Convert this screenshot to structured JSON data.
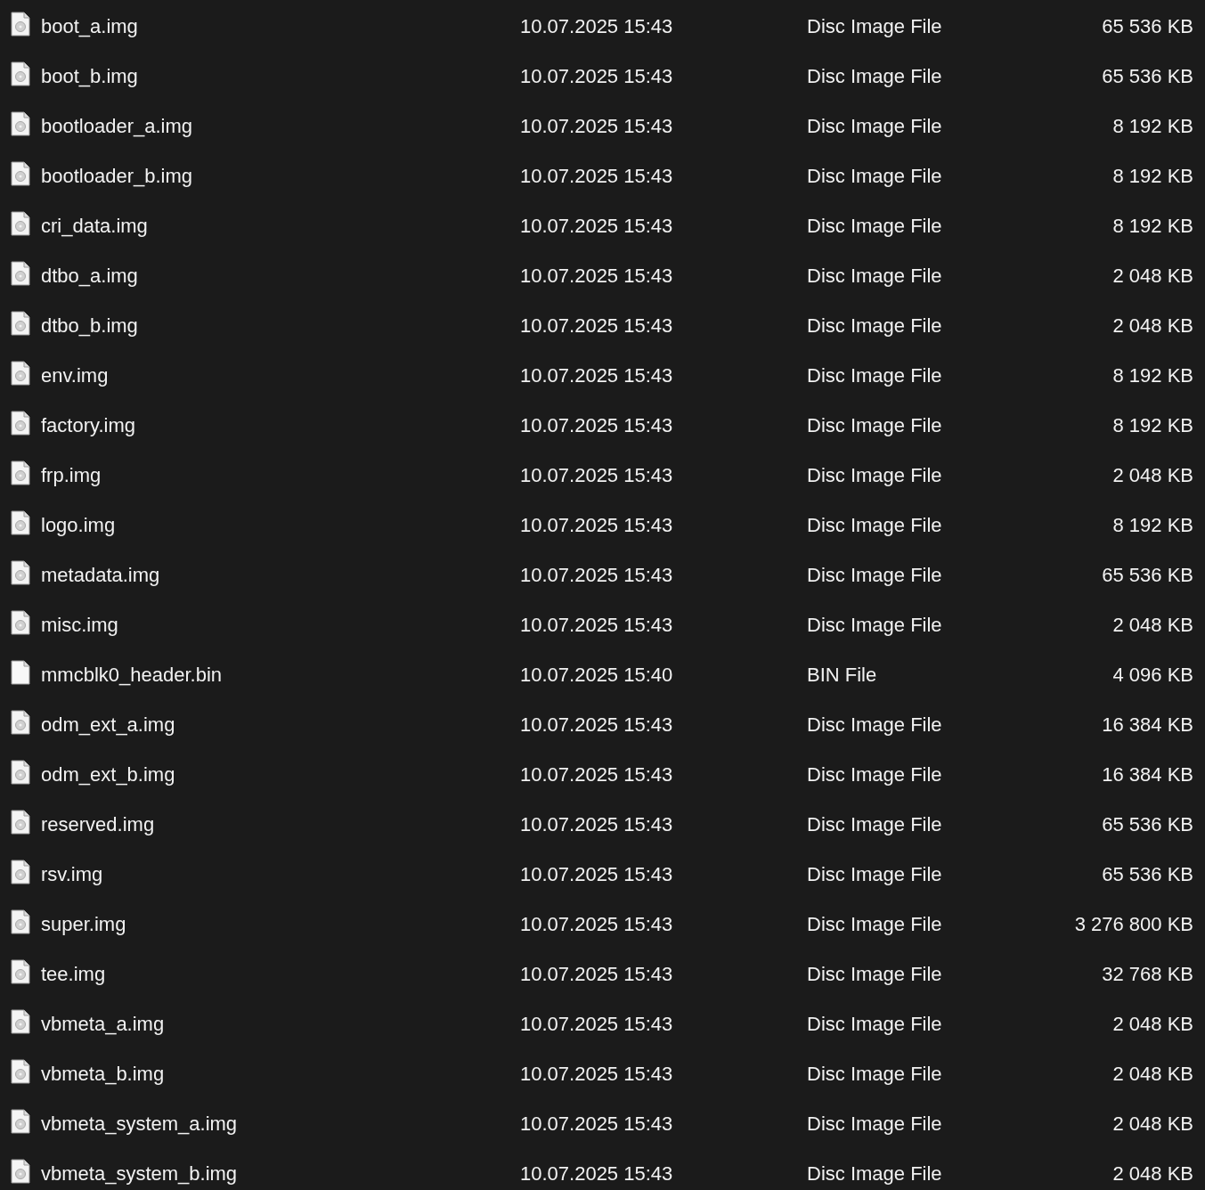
{
  "files": [
    {
      "kind": "disc",
      "name": "boot_a.img",
      "modified": "10.07.2025 15:43",
      "type": "Disc Image File",
      "size": "65 536 KB"
    },
    {
      "kind": "disc",
      "name": "boot_b.img",
      "modified": "10.07.2025 15:43",
      "type": "Disc Image File",
      "size": "65 536 KB"
    },
    {
      "kind": "disc",
      "name": "bootloader_a.img",
      "modified": "10.07.2025 15:43",
      "type": "Disc Image File",
      "size": "8 192 KB"
    },
    {
      "kind": "disc",
      "name": "bootloader_b.img",
      "modified": "10.07.2025 15:43",
      "type": "Disc Image File",
      "size": "8 192 KB"
    },
    {
      "kind": "disc",
      "name": "cri_data.img",
      "modified": "10.07.2025 15:43",
      "type": "Disc Image File",
      "size": "8 192 KB"
    },
    {
      "kind": "disc",
      "name": "dtbo_a.img",
      "modified": "10.07.2025 15:43",
      "type": "Disc Image File",
      "size": "2 048 KB"
    },
    {
      "kind": "disc",
      "name": "dtbo_b.img",
      "modified": "10.07.2025 15:43",
      "type": "Disc Image File",
      "size": "2 048 KB"
    },
    {
      "kind": "disc",
      "name": "env.img",
      "modified": "10.07.2025 15:43",
      "type": "Disc Image File",
      "size": "8 192 KB"
    },
    {
      "kind": "disc",
      "name": "factory.img",
      "modified": "10.07.2025 15:43",
      "type": "Disc Image File",
      "size": "8 192 KB"
    },
    {
      "kind": "disc",
      "name": "frp.img",
      "modified": "10.07.2025 15:43",
      "type": "Disc Image File",
      "size": "2 048 KB"
    },
    {
      "kind": "disc",
      "name": "logo.img",
      "modified": "10.07.2025 15:43",
      "type": "Disc Image File",
      "size": "8 192 KB"
    },
    {
      "kind": "disc",
      "name": "metadata.img",
      "modified": "10.07.2025 15:43",
      "type": "Disc Image File",
      "size": "65 536 KB"
    },
    {
      "kind": "disc",
      "name": "misc.img",
      "modified": "10.07.2025 15:43",
      "type": "Disc Image File",
      "size": "2 048 KB"
    },
    {
      "kind": "blank",
      "name": "mmcblk0_header.bin",
      "modified": "10.07.2025 15:40",
      "type": "BIN File",
      "size": "4 096 KB"
    },
    {
      "kind": "disc",
      "name": "odm_ext_a.img",
      "modified": "10.07.2025 15:43",
      "type": "Disc Image File",
      "size": "16 384 KB"
    },
    {
      "kind": "disc",
      "name": "odm_ext_b.img",
      "modified": "10.07.2025 15:43",
      "type": "Disc Image File",
      "size": "16 384 KB"
    },
    {
      "kind": "disc",
      "name": "reserved.img",
      "modified": "10.07.2025 15:43",
      "type": "Disc Image File",
      "size": "65 536 KB"
    },
    {
      "kind": "disc",
      "name": "rsv.img",
      "modified": "10.07.2025 15:43",
      "type": "Disc Image File",
      "size": "65 536 KB"
    },
    {
      "kind": "disc",
      "name": "super.img",
      "modified": "10.07.2025 15:43",
      "type": "Disc Image File",
      "size": "3 276 800 KB"
    },
    {
      "kind": "disc",
      "name": "tee.img",
      "modified": "10.07.2025 15:43",
      "type": "Disc Image File",
      "size": "32 768 KB"
    },
    {
      "kind": "disc",
      "name": "vbmeta_a.img",
      "modified": "10.07.2025 15:43",
      "type": "Disc Image File",
      "size": "2 048 KB"
    },
    {
      "kind": "disc",
      "name": "vbmeta_b.img",
      "modified": "10.07.2025 15:43",
      "type": "Disc Image File",
      "size": "2 048 KB"
    },
    {
      "kind": "disc",
      "name": "vbmeta_system_a.img",
      "modified": "10.07.2025 15:43",
      "type": "Disc Image File",
      "size": "2 048 KB"
    },
    {
      "kind": "disc",
      "name": "vbmeta_system_b.img",
      "modified": "10.07.2025 15:43",
      "type": "Disc Image File",
      "size": "2 048 KB"
    }
  ]
}
